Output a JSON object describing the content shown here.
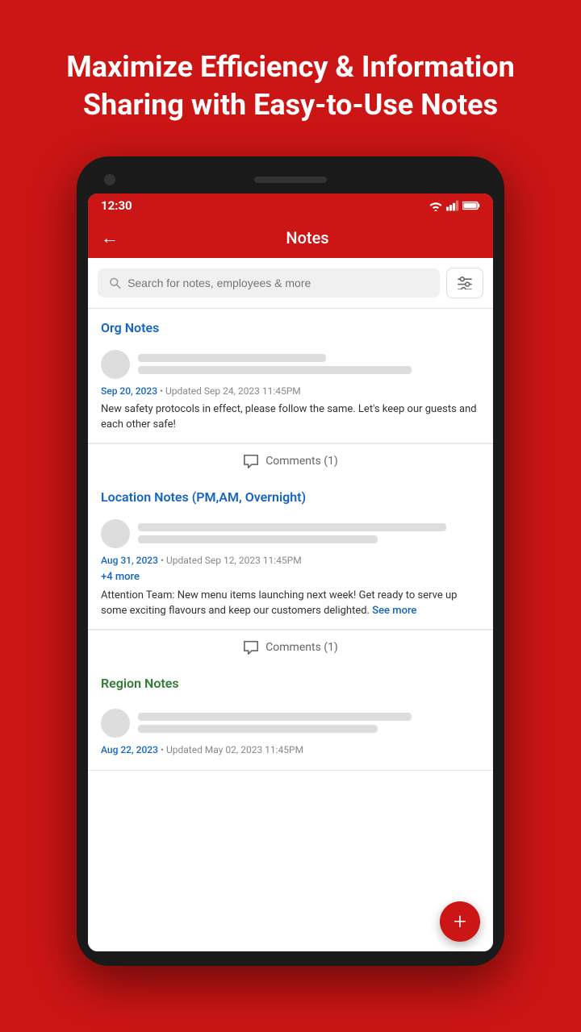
{
  "hero": {
    "text": "Maximize Efficiency & Information Sharing with Easy-to-Use Notes"
  },
  "status_bar": {
    "time": "12:30"
  },
  "header": {
    "title": "Notes",
    "back_label": "←"
  },
  "search": {
    "placeholder": "Search for notes, employees & more"
  },
  "sections": [
    {
      "id": "org",
      "header": "Org Notes",
      "header_color": "blue",
      "notes": [
        {
          "date": "Sep 20, 2023",
          "updated": "• Updated Sep 24, 2023 11:45PM",
          "text": "New safety protocols in effect, please follow the same. Let's keep our guests and each other safe!",
          "comments": "Comments (1)",
          "see_more": false,
          "more_tag": null
        }
      ]
    },
    {
      "id": "location",
      "header": "Location Notes (PM,AM, Overnight)",
      "header_color": "blue",
      "notes": [
        {
          "date": "Aug 31, 2023",
          "updated": "• Updated Sep 12, 2023 11:45PM",
          "text": "Attention Team: New menu items launching next week! Get ready to serve up some exciting flavours and keep our customers delighted.",
          "comments": "Comments (1)",
          "see_more": true,
          "see_more_label": "See more",
          "more_tag": "+4 more"
        }
      ]
    },
    {
      "id": "region",
      "header": "Region Notes",
      "header_color": "green",
      "notes": [
        {
          "date": "Aug 22, 2023",
          "updated": "• Updated May 02, 2023 11:45PM",
          "text": "",
          "comments": null,
          "see_more": false,
          "more_tag": null
        }
      ]
    }
  ],
  "fab": {
    "label": "+"
  }
}
